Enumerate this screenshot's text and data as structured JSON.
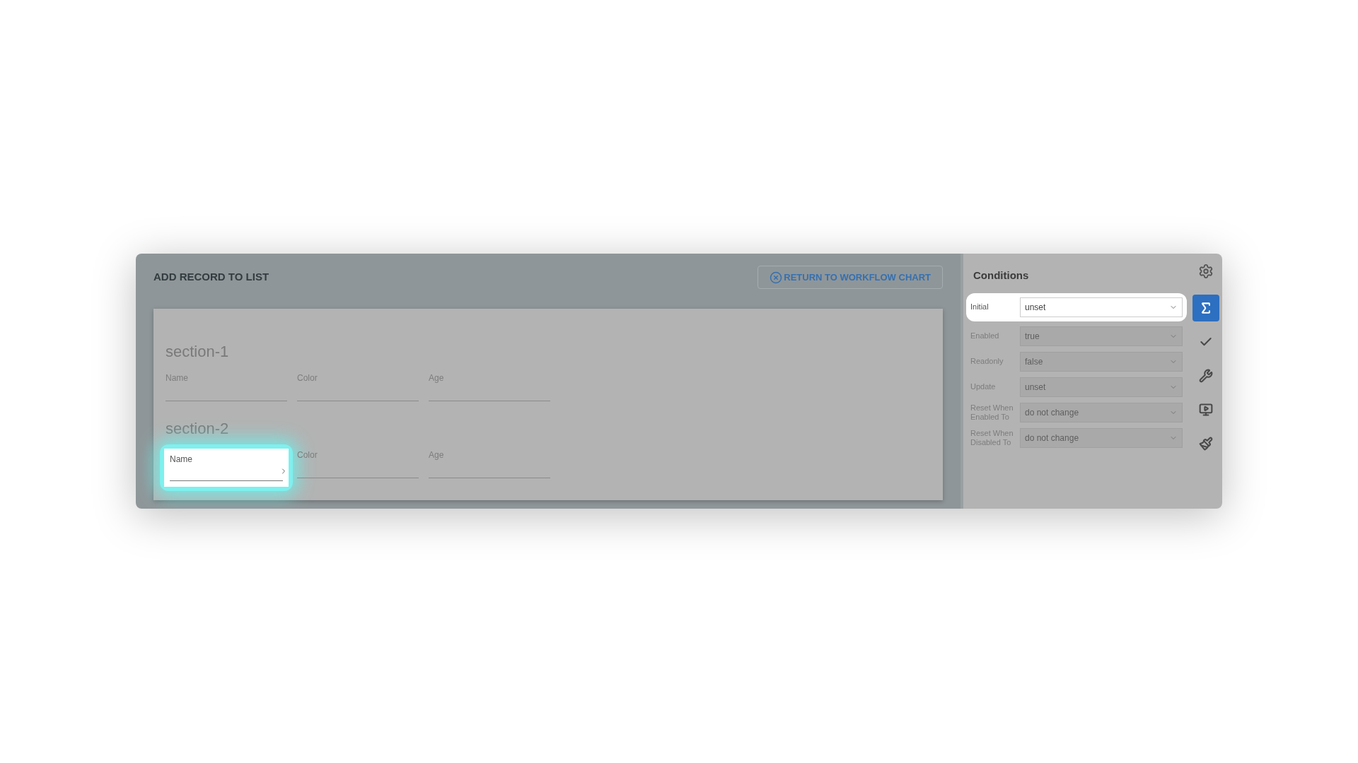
{
  "header": {
    "title": "ADD RECORD TO LIST",
    "return_button": "RETURN TO WORKFLOW CHART"
  },
  "sections": [
    {
      "title": "section-1",
      "fields": [
        {
          "label": "Name",
          "highlighted": false
        },
        {
          "label": "Color",
          "highlighted": false
        },
        {
          "label": "Age",
          "highlighted": false
        }
      ]
    },
    {
      "title": "section-2",
      "fields": [
        {
          "label": "Name",
          "highlighted": true
        },
        {
          "label": "Color",
          "highlighted": false
        },
        {
          "label": "Age",
          "highlighted": false
        }
      ]
    }
  ],
  "conditions": {
    "title": "Conditions",
    "rows": [
      {
        "label": "Initial",
        "value": "unset",
        "highlighted": true
      },
      {
        "label": "Enabled",
        "value": "true",
        "highlighted": false
      },
      {
        "label": "Readonly",
        "value": "false",
        "highlighted": false
      },
      {
        "label": "Update",
        "value": "unset",
        "highlighted": false
      },
      {
        "label": "Reset When Enabled To",
        "value": "do not change",
        "highlighted": false
      },
      {
        "label": "Reset When Disabled To",
        "value": "do not change",
        "highlighted": false
      }
    ]
  },
  "side_tools": [
    {
      "kind": "sigma",
      "selected": true
    },
    {
      "kind": "check",
      "selected": false
    },
    {
      "kind": "wrench",
      "selected": false
    },
    {
      "kind": "video",
      "selected": false
    },
    {
      "kind": "brush",
      "selected": false
    }
  ]
}
